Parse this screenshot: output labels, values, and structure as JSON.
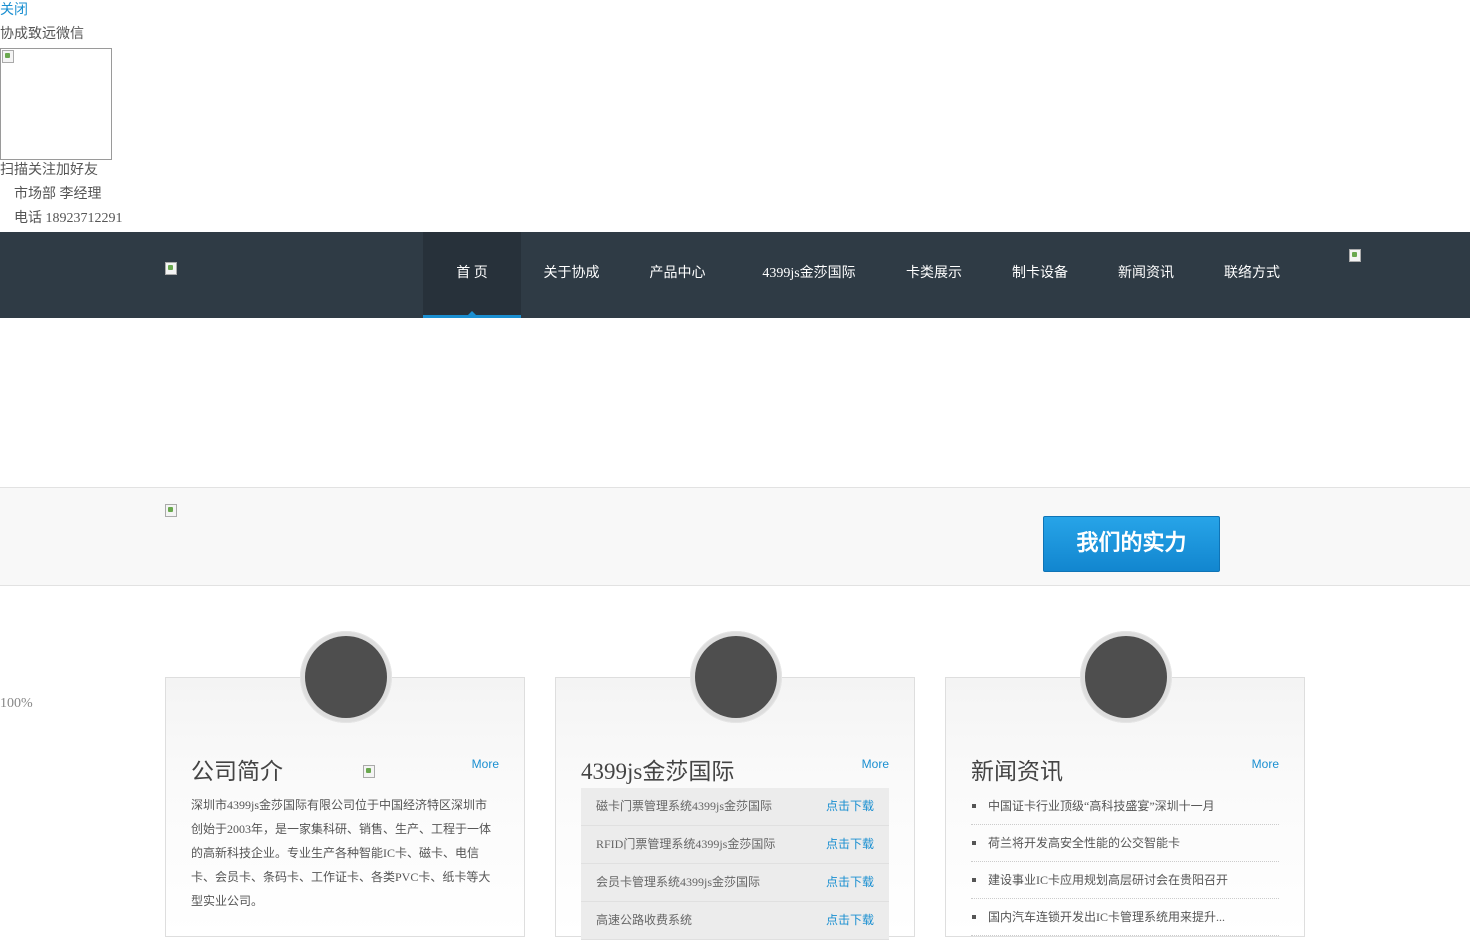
{
  "wechat": {
    "close_label": "关闭",
    "title": "协成致远微信",
    "scan_text": "扫描关注加好友",
    "department": "市场部 李经理",
    "phone": "电话 18923712291"
  },
  "nav": {
    "items": [
      {
        "label": "首 页",
        "has_caret": false,
        "active": true
      },
      {
        "label": "关于协成",
        "has_caret": true,
        "active": false
      },
      {
        "label": "产品中心",
        "has_caret": true,
        "active": false
      },
      {
        "label": "4399js金莎国际",
        "has_caret": false,
        "active": false
      },
      {
        "label": "卡类展示",
        "has_caret": false,
        "active": false
      },
      {
        "label": "制卡设备",
        "has_caret": false,
        "active": false
      },
      {
        "label": "新闻资讯",
        "has_caret": false,
        "active": false
      },
      {
        "label": "联络方式",
        "has_caret": false,
        "active": false
      }
    ],
    "caret_glyph": ""
  },
  "strength": {
    "button_label": "我们的实力"
  },
  "percent_text": "100%",
  "cards": {
    "about": {
      "icon_glyph": "",
      "title": "公司简介",
      "more": "More",
      "text": "深圳市4399js金莎国际有限公司位于中国经济特区深圳市创始于2003年，是一家集科研、销售、生产、工程于一体的高新科技企业。专业生产各种智能IC卡、磁卡、电信卡、会员卡、条码卡、工作证卡、各类PVC卡、纸卡等大型实业公司。"
    },
    "downloads": {
      "icon_glyph": "",
      "title": "4399js金莎国际",
      "more": "More",
      "items": [
        {
          "name": "磁卡门票管理系统4399js金莎国际",
          "link": "点击下载"
        },
        {
          "name": "RFID门票管理系统4399js金莎国际",
          "link": "点击下载"
        },
        {
          "name": "会员卡管理系统4399js金莎国际",
          "link": "点击下载"
        },
        {
          "name": "高速公路收费系统",
          "link": "点击下载"
        }
      ]
    },
    "news": {
      "icon_glyph": "",
      "title": "新闻资讯",
      "more": "More",
      "items": [
        "中国证卡行业顶级“高科技盛宴”深圳十一月",
        "荷兰将开发高安全性能的公交智能卡",
        "建设事业IC卡应用规划高层研讨会在贵阳召开",
        "国内汽车连锁开发出IC卡管理系统用来提升..."
      ]
    }
  },
  "colors": {
    "nav_bg": "#2f3b45",
    "accent": "#1a8fd1"
  }
}
